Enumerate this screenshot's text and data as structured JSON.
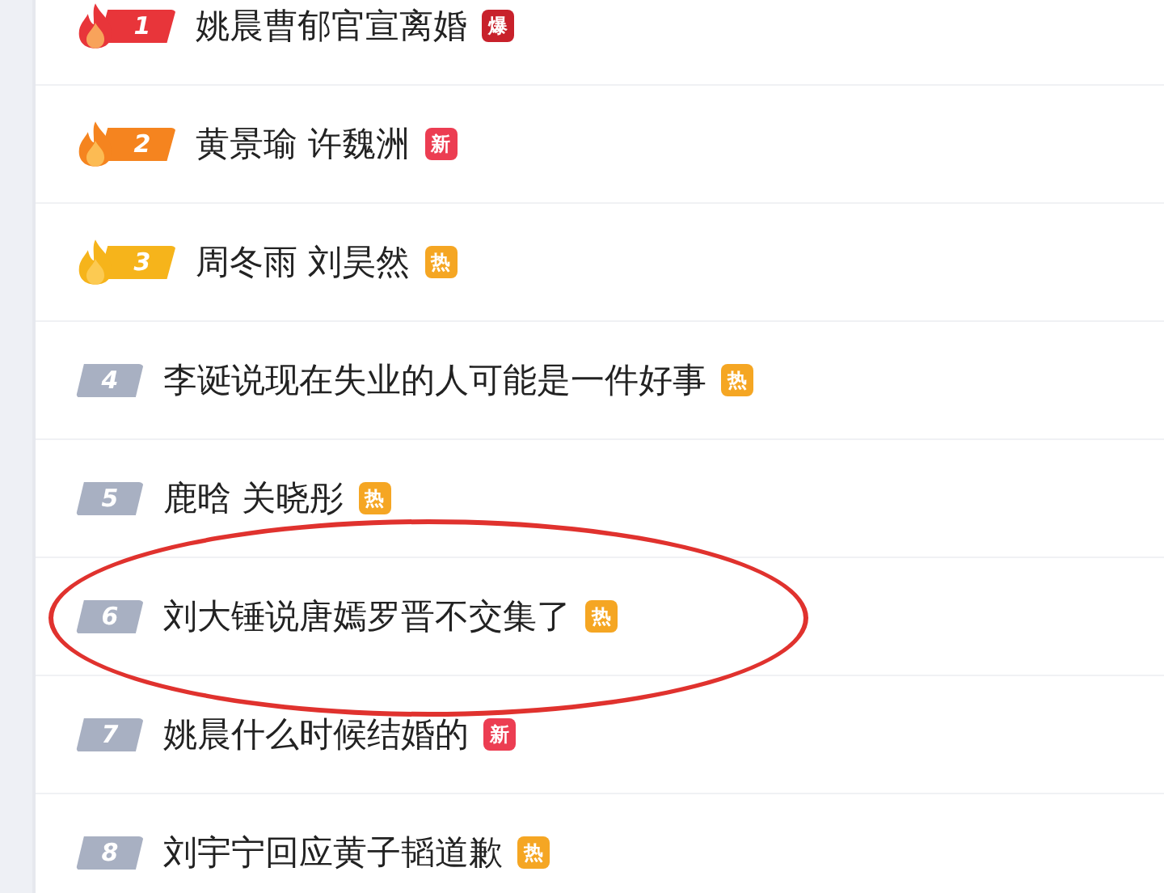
{
  "items": [
    {
      "rank": "1",
      "kind": "flame",
      "color": "#e8353a",
      "title": "姚晨曹郁官宣离婚",
      "badge": {
        "text": "爆",
        "color": "#c8212b"
      },
      "circled": false
    },
    {
      "rank": "2",
      "kind": "flame",
      "color": "#f5841f",
      "title": "黄景瑜 许魏洲",
      "badge": {
        "text": "新",
        "color": "#ec3d52"
      },
      "circled": false
    },
    {
      "rank": "3",
      "kind": "flame",
      "color": "#f6b41b",
      "title": "周冬雨 刘昊然",
      "badge": {
        "text": "热",
        "color": "#f5a623"
      },
      "circled": false
    },
    {
      "rank": "4",
      "kind": "plain",
      "color": "#a8b0c2",
      "title": "李诞说现在失业的人可能是一件好事",
      "badge": {
        "text": "热",
        "color": "#f5a623"
      },
      "circled": false
    },
    {
      "rank": "5",
      "kind": "plain",
      "color": "#a8b0c2",
      "title": "鹿晗 关晓彤",
      "badge": {
        "text": "热",
        "color": "#f5a623"
      },
      "circled": false
    },
    {
      "rank": "6",
      "kind": "plain",
      "color": "#a8b0c2",
      "title": "刘大锤说唐嫣罗晋不交集了",
      "badge": {
        "text": "热",
        "color": "#f5a623"
      },
      "circled": true
    },
    {
      "rank": "7",
      "kind": "plain",
      "color": "#a8b0c2",
      "title": "姚晨什么时候结婚的",
      "badge": {
        "text": "新",
        "color": "#ec3d52"
      },
      "circled": false
    },
    {
      "rank": "8",
      "kind": "plain",
      "color": "#a8b0c2",
      "title": "刘宇宁回应黄子韬道歉",
      "badge": {
        "text": "热",
        "color": "#f5a623"
      },
      "circled": false
    }
  ]
}
